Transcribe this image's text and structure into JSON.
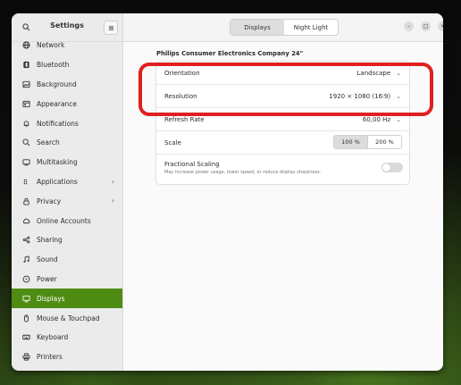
{
  "window": {
    "title": "Settings"
  },
  "sidebar": {
    "items": [
      {
        "label": "Network",
        "icon": "network-icon"
      },
      {
        "label": "Bluetooth",
        "icon": "bluetooth-icon"
      },
      {
        "label": "Background",
        "icon": "background-icon"
      },
      {
        "label": "Appearance",
        "icon": "appearance-icon"
      },
      {
        "label": "Notifications",
        "icon": "bell-icon"
      },
      {
        "label": "Search",
        "icon": "search-icon"
      },
      {
        "label": "Multitasking",
        "icon": "multitasking-icon"
      },
      {
        "label": "Applications",
        "icon": "apps-icon",
        "chevron": "›"
      },
      {
        "label": "Privacy",
        "icon": "lock-icon",
        "chevron": "›"
      },
      {
        "label": "Online Accounts",
        "icon": "cloud-icon"
      },
      {
        "label": "Sharing",
        "icon": "share-icon"
      },
      {
        "label": "Sound",
        "icon": "music-note-icon"
      },
      {
        "label": "Power",
        "icon": "power-icon"
      },
      {
        "label": "Displays",
        "icon": "display-icon",
        "active": true
      },
      {
        "label": "Mouse & Touchpad",
        "icon": "mouse-icon"
      },
      {
        "label": "Keyboard",
        "icon": "keyboard-icon"
      },
      {
        "label": "Printers",
        "icon": "printer-icon"
      }
    ]
  },
  "tabs": {
    "displays": "Displays",
    "night_light": "Night Light"
  },
  "monitor": {
    "name": "Philips Consumer Electronics Company 24\""
  },
  "settings": {
    "orientation": {
      "label": "Orientation",
      "value": "Landscape"
    },
    "resolution": {
      "label": "Resolution",
      "value": "1920 × 1080 (16∶9)"
    },
    "refresh_rate": {
      "label": "Refresh Rate",
      "value": "60,00 Hz"
    },
    "scale": {
      "label": "Scale",
      "options": [
        "100 %",
        "200 %"
      ],
      "selected": "100 %"
    },
    "fractional": {
      "label": "Fractional Scaling",
      "description": "May increase power usage, lower speed, or reduce display sharpness.",
      "enabled": false
    }
  },
  "colors": {
    "accent": "#4e8c14",
    "highlight": "#e02020"
  }
}
